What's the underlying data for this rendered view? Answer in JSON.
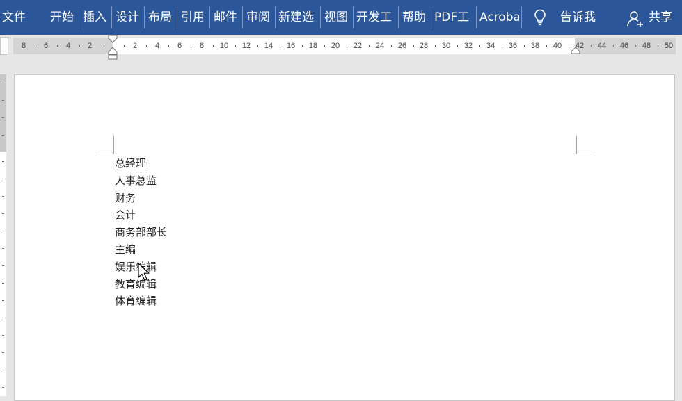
{
  "ribbon": {
    "tabs": [
      {
        "label": "文件"
      },
      {
        "label": "开始"
      },
      {
        "label": "插入"
      },
      {
        "label": "设计"
      },
      {
        "label": "布局"
      },
      {
        "label": "引用"
      },
      {
        "label": "邮件"
      },
      {
        "label": "审阅"
      },
      {
        "label": "新建选"
      },
      {
        "label": "视图"
      },
      {
        "label": "开发工"
      },
      {
        "label": "帮助"
      },
      {
        "label": "PDF工"
      },
      {
        "label": "Acroba"
      }
    ],
    "tell_me": "告诉我",
    "share": "共享",
    "bulb_icon": "lightbulb-icon",
    "share_icon": "person-add-icon"
  },
  "ruler": {
    "left_labels": [
      "8",
      "6",
      "4",
      "2"
    ],
    "main_labels": [
      "2",
      "4",
      "6",
      "8",
      "10",
      "12",
      "14",
      "16",
      "18",
      "20",
      "22",
      "24",
      "26",
      "28",
      "30",
      "32",
      "34",
      "36",
      "38",
      "40"
    ],
    "right_labels": [
      "42",
      "44",
      "46",
      "48",
      "50"
    ]
  },
  "document": {
    "lines": [
      "总经理",
      "人事总监",
      "财务",
      "会计",
      "商务部部长",
      "主编",
      "娱乐编辑",
      "教育编辑",
      "体育编辑"
    ]
  },
  "colors": {
    "ribbon": "#2b579a",
    "ruler_margin": "#d4d4d4",
    "page": "#ffffff"
  }
}
